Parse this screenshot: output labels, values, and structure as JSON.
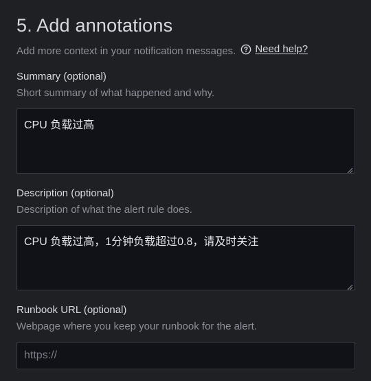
{
  "section": {
    "title": "5. Add annotations",
    "description": "Add more context in your notification messages.",
    "help_label": "Need help?",
    "help_icon": "question-circle-icon"
  },
  "summary": {
    "label": "Summary (optional)",
    "description": "Short summary of what happened and why.",
    "value": "CPU 负载过高"
  },
  "description_field": {
    "label": "Description (optional)",
    "description": "Description of what the alert rule does.",
    "value": "CPU 负载过高，1分钟负载超过0.8，请及时关注"
  },
  "runbook": {
    "label": "Runbook URL (optional)",
    "description": "Webpage where you keep your runbook for the alert.",
    "placeholder": "https://",
    "value": ""
  },
  "colors": {
    "background": "#1f2024",
    "input_background": "#111217",
    "border": "#3a3b42",
    "text_primary": "#d8d9e0",
    "text_secondary": "#8e8f98"
  }
}
